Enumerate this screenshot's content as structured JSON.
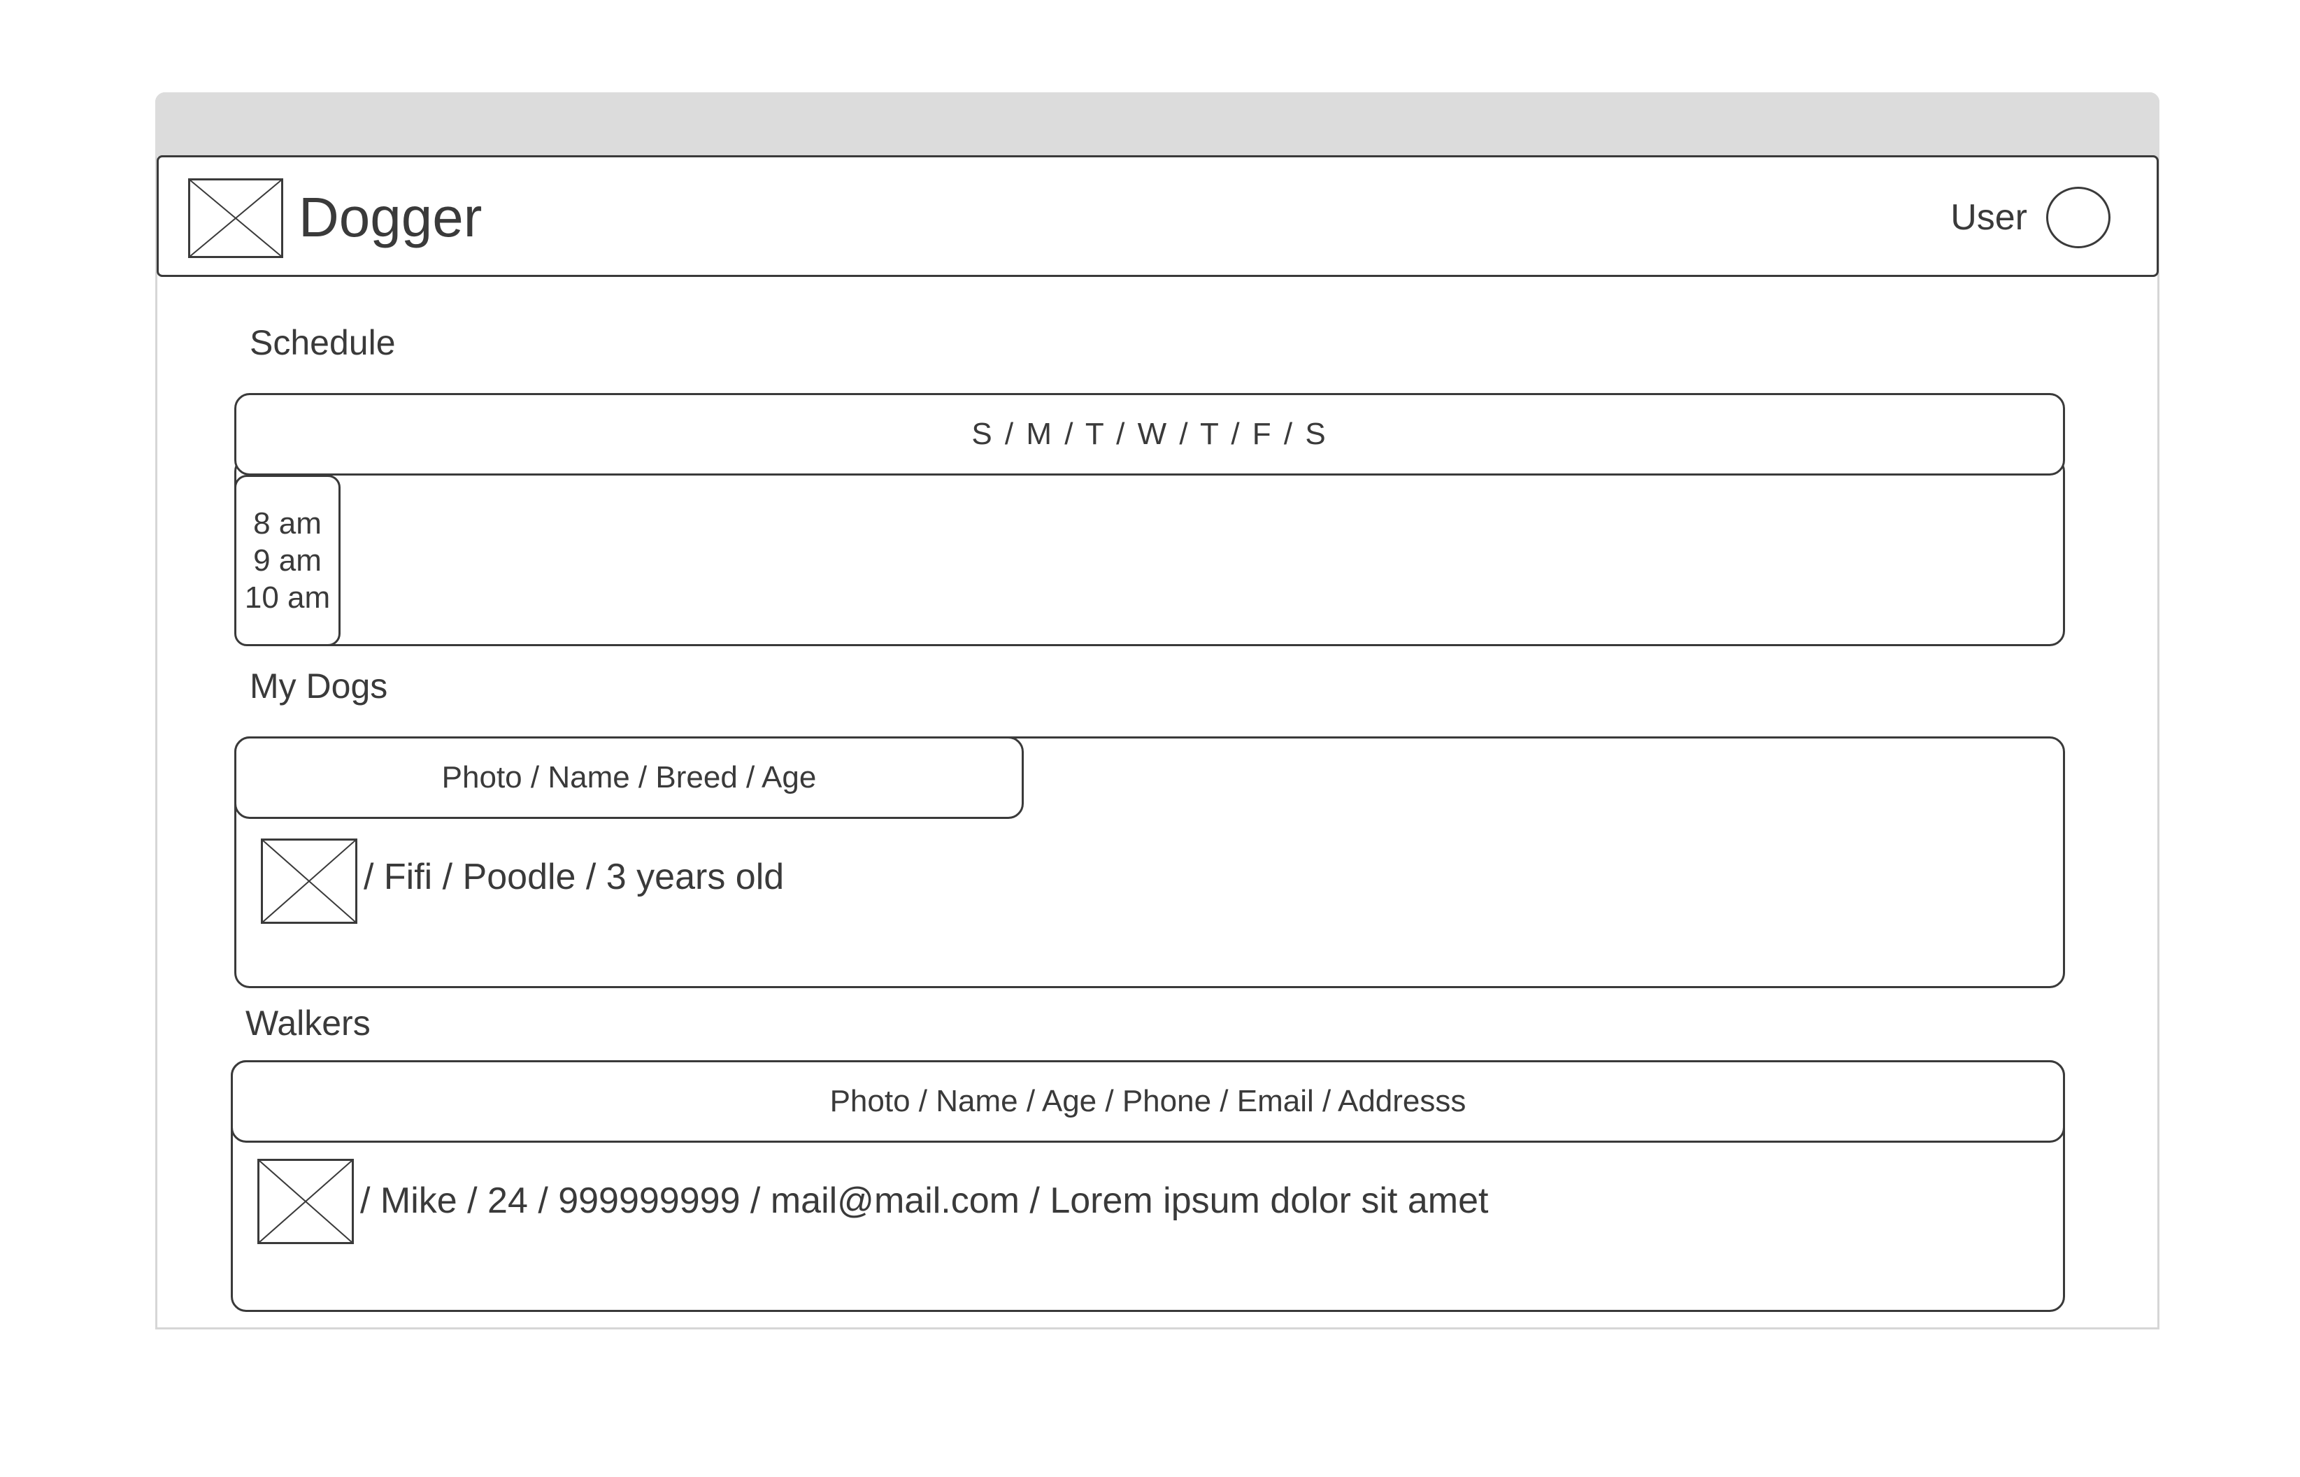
{
  "app": {
    "title": "Dogger",
    "user_label": "User"
  },
  "schedule": {
    "label": "Schedule",
    "days_header": "S / M / T / W / T / F / S",
    "times": [
      "8 am",
      "9 am",
      "10 am"
    ]
  },
  "dogs": {
    "label": "My Dogs",
    "columns_header": "Photo / Name / Breed / Age",
    "rows": [
      {
        "details": "/ Fifi / Poodle / 3 years old"
      }
    ]
  },
  "walkers": {
    "label": "Walkers",
    "columns_header": "Photo / Name / Age / Phone / Email / Addresss",
    "rows": [
      {
        "details": "/ Mike / 24 / 999999999 / mail@mail.com / Lorem ipsum dolor sit amet"
      }
    ]
  },
  "icons": {
    "logo": "image-placeholder-icon",
    "avatar": "avatar-circle-icon",
    "row_photo": "image-placeholder-icon"
  },
  "colors": {
    "stroke": "#3a3a3a",
    "titlebar": "#dcdcdc",
    "window_border": "#d6d6d6"
  }
}
